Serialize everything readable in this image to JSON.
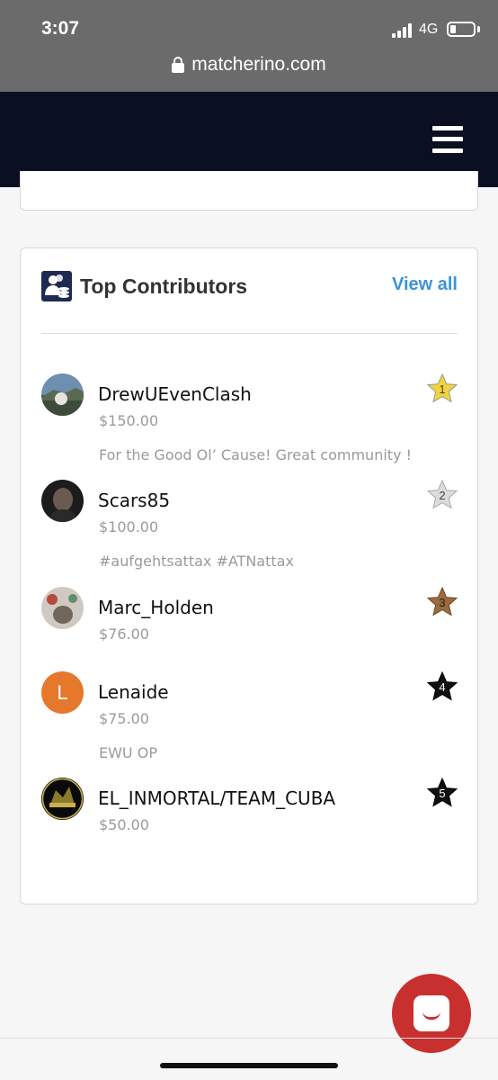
{
  "status_bar": {
    "time": "3:07",
    "network": "4G"
  },
  "browser": {
    "url": "matcherino.com"
  },
  "section": {
    "title": "Top Contributors",
    "view_all": "View all"
  },
  "contributors": [
    {
      "name": "DrewUEvenClash",
      "amount": "$150.00",
      "message": "For the Good Ol’ Cause! Great community !",
      "rank": "1",
      "star_color": "#f2d43a",
      "rank_text_color": "#444"
    },
    {
      "name": "Scars85",
      "amount": "$100.00",
      "message": "#aufgehtsattax #ATNattax",
      "rank": "2",
      "star_color": "#dcdcdc",
      "rank_text_color": "#444"
    },
    {
      "name": "Marc_Holden",
      "amount": "$76.00",
      "message": "",
      "rank": "3",
      "star_color": "#9b6a3f",
      "rank_text_color": "#222"
    },
    {
      "name": "Lenaide",
      "amount": "$75.00",
      "message": "EWU OP",
      "rank": "4",
      "star_color": "#111111",
      "rank_text_color": "#fff",
      "avatar_letter": "L",
      "avatar_color": "#e5782a"
    },
    {
      "name": "EL_INMORTAL/TEAM_CUBA",
      "amount": "$50.00",
      "message": "",
      "rank": "5",
      "star_color": "#111111",
      "rank_text_color": "#fff"
    }
  ]
}
